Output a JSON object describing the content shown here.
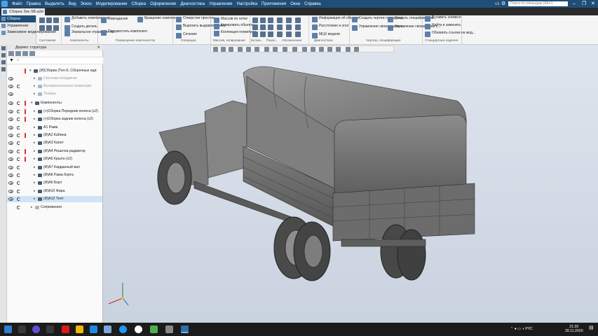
{
  "titlebar": {
    "menus": [
      "Файл",
      "Правка",
      "Выделить",
      "Вид",
      "Эскиз",
      "Моделирование",
      "Сборка",
      "Оформление",
      "Диагностика",
      "Управление",
      "Настройка",
      "Приложения",
      "Окна",
      "Справка"
    ],
    "search_placeholder": "Поиск по командам (Alt+/)"
  },
  "document_tab": "Сборка Зис-5В.a3d",
  "ribbon": {
    "modes": [
      "Сборка",
      "Управление",
      "Зависимое моделирование"
    ],
    "groups": {
      "system": "Системная",
      "components": "Компоненты",
      "placement": "Размещение компонентов",
      "operations": "Операции",
      "mass_coupling": "Массив, копирование",
      "aux": "Вспом...",
      "parts": "Разре...",
      "designations": "Обозначения",
      "diagnostics": "Диагностика",
      "drawing_spec": "Чертеж, спецификация",
      "standard_products": "Стандартные изделия"
    },
    "commands": {
      "add_component": "Добавить компонент из...",
      "create_part": "Создать деталь",
      "mirror_component": "Зеркальное отражение ко...",
      "coincidence": "Совпадение",
      "rotate_component": "Вращение компонента",
      "move_component": "Переместить компонент",
      "hole_simple": "Отверстие простое",
      "cut_extrude": "Вырезать выдавливанием",
      "section": "Сечение",
      "array_grid": "Массив по сетке",
      "copy_objects": "Копировать объекты",
      "geometry_collection": "Коллекция геометрии",
      "info_object": "Информация об объекте",
      "distance_angle": "Расстояние и угол",
      "mcc_model": "МЦХ модели",
      "create_drawing": "Создать чертеж по модели",
      "manage_linked_1": "Управление связанными ч...",
      "create_spec": "Создать спецификацию...",
      "manage_linked_2": "Управление связанными с...",
      "insert_element": "Вставить элемент",
      "find_replace": "Найти и заменить",
      "update_links": "Обновить ссылки на мод..."
    }
  },
  "tree": {
    "panel_title": "Дерево: структура",
    "rows": [
      {
        "label": "(И)Сборка (Тел-0, Сборочных еди",
        "icon": "assembly-icon"
      },
      {
        "label": "Системы координат",
        "icon": "coordinate-system-icon"
      },
      {
        "label": "Вспомогательная геометрия",
        "icon": "aux-geometry-icon"
      },
      {
        "label": "Эскизы",
        "icon": "sketch-icon"
      },
      {
        "label": "Компоненты",
        "icon": "components-icon"
      },
      {
        "label": "(+)Сборка Передние колеса (x2)",
        "icon": "subassembly-icon"
      },
      {
        "label": "(+)Сборка задние колеса (x2)",
        "icon": "subassembly-icon"
      },
      {
        "label": "A1 Рама",
        "icon": "part-icon"
      },
      {
        "label": "(И)A2 Кабина",
        "icon": "part-icon"
      },
      {
        "label": "(И)A3 Капот",
        "icon": "part-icon"
      },
      {
        "label": "(И)A4 Решетка радиатор",
        "icon": "part-icon"
      },
      {
        "label": "(И)A5 Крыло (x2)",
        "icon": "part-icon"
      },
      {
        "label": "(И)A7 Карданный вал",
        "icon": "part-icon"
      },
      {
        "label": "(И)A8 Рама борта",
        "icon": "part-icon"
      },
      {
        "label": "(И)A9 Борт",
        "icon": "part-icon"
      },
      {
        "label": "(И)A10 Фара",
        "icon": "part-icon"
      },
      {
        "label": "(И)A12 Тент",
        "icon": "part-icon"
      },
      {
        "label": "Сопряжения",
        "icon": "mates-icon"
      }
    ]
  },
  "viewport": {
    "model": "Зис-5В truck assembly with canvas tent"
  },
  "taskbar": {
    "language": "РУС",
    "time": "21:20",
    "date": "28.11.2020"
  }
}
